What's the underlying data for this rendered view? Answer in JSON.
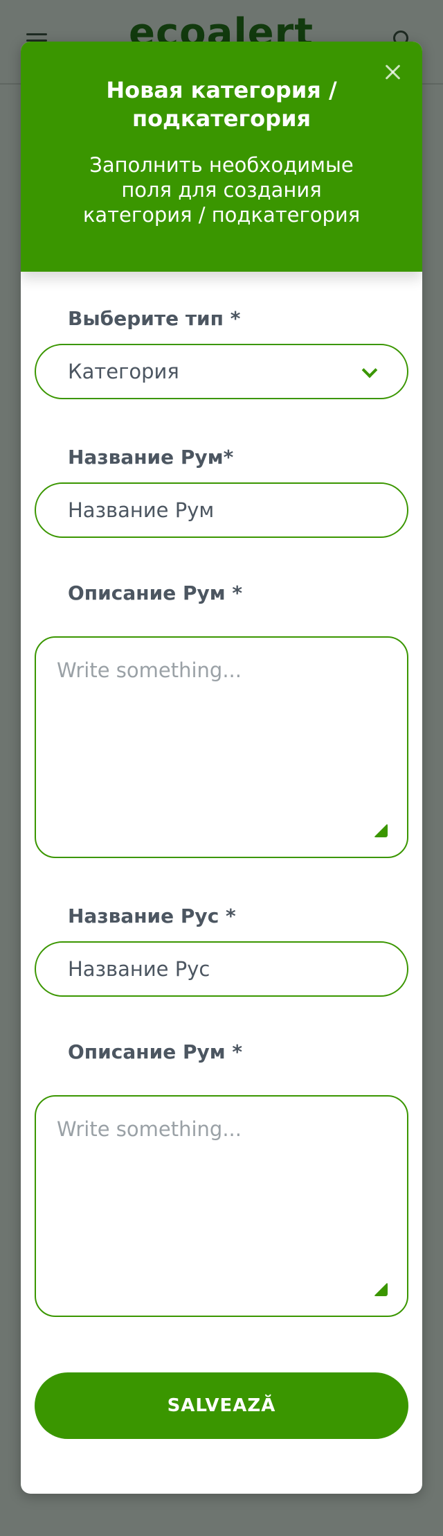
{
  "background": {
    "logo_text": "ecoalert"
  },
  "modal": {
    "title": "Новая категория / подкатегория",
    "subtitle": "Заполнить необходимые поля для создания категория / подкатегория",
    "type_field": {
      "label": "Выберите тип *",
      "selected": "Категория"
    },
    "name_rum": {
      "label": "Название Рум*",
      "placeholder": "Название Рум"
    },
    "desc_rum": {
      "label": "Описание Рум *",
      "placeholder": "Write something..."
    },
    "name_rus": {
      "label": "Название Рус *",
      "placeholder": "Название Рус"
    },
    "desc_rus": {
      "label": "Описание Рум *",
      "placeholder": "Write something..."
    },
    "save_label": "SALVEAZĂ"
  },
  "colors": {
    "accent": "#3a9600",
    "label": "#4c5661",
    "overlay": "#6e7570"
  }
}
